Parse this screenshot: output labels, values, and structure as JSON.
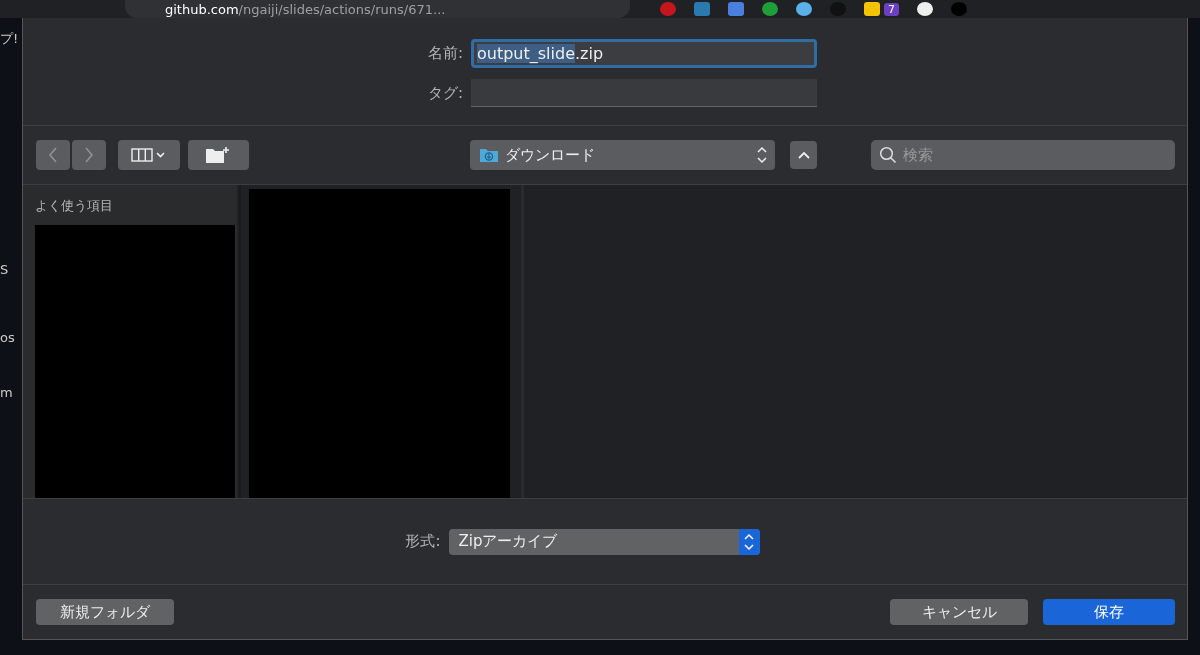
{
  "browser": {
    "address_host": "github.com",
    "address_path": "/ngaiji/slides/actions/runs/671...",
    "extension_badge": "7",
    "page_fragments": [
      "プ!",
      "S",
      "os",
      "m"
    ]
  },
  "save_dialog": {
    "name_row": {
      "label": "名前:",
      "value_parts": [
        {
          "text": "output_slide",
          "selected": true
        },
        {
          "text": ".zip",
          "selected": false
        }
      ]
    },
    "tags_row": {
      "label": "タグ:"
    },
    "toolbar": {
      "back_disabled": true,
      "forward_disabled": true,
      "location": "ダウンロード",
      "search": {
        "placeholder": "検索"
      }
    },
    "sidebar": {
      "heading": "よく使う項目"
    },
    "format_row": {
      "label": "形式:",
      "value": "Zipアーカイブ"
    },
    "buttons": [
      {
        "label": "新規フォルダ",
        "kind": "secondary"
      },
      {
        "label": "キャンセル",
        "kind": "secondary"
      },
      {
        "label": "保存",
        "kind": "primary"
      }
    ]
  }
}
